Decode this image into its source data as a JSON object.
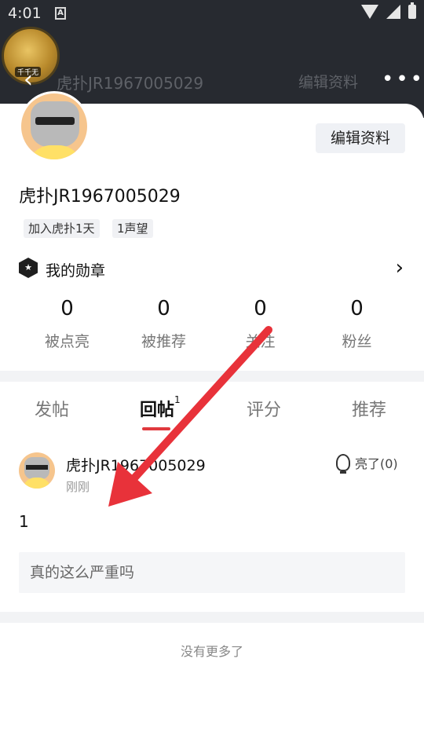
{
  "status": {
    "time": "4:01",
    "notify_icon": "A"
  },
  "nav": {
    "back_icon": "‹",
    "title": "虎扑JR1967005029",
    "edit_label": "编辑资料",
    "more_icon": "•••"
  },
  "medal_badge_text": "千千无",
  "profile": {
    "edit_button": "编辑资料",
    "username": "虎扑JR1967005029",
    "tags": [
      "加入虎扑1天",
      "1声望"
    ],
    "medal_label": "我的勋章",
    "medal_chevron": "›",
    "stats": [
      {
        "num": "0",
        "label": "被点亮"
      },
      {
        "num": "0",
        "label": "被推荐"
      },
      {
        "num": "0",
        "label": "关注"
      },
      {
        "num": "0",
        "label": "粉丝"
      }
    ]
  },
  "tabs": [
    {
      "label": "发帖"
    },
    {
      "label": "回帖",
      "count": "1"
    },
    {
      "label": "评分"
    },
    {
      "label": "推荐"
    }
  ],
  "post": {
    "author": "虎扑JR1967005029",
    "time": "刚刚",
    "light_label": "亮了(0)",
    "content": "1",
    "quote": "真的这么严重吗"
  },
  "footer": {
    "no_more": "没有更多了"
  },
  "colors": {
    "accent": "#e0393e",
    "header_bg": "#272a30",
    "arrow": "#e8323a"
  }
}
